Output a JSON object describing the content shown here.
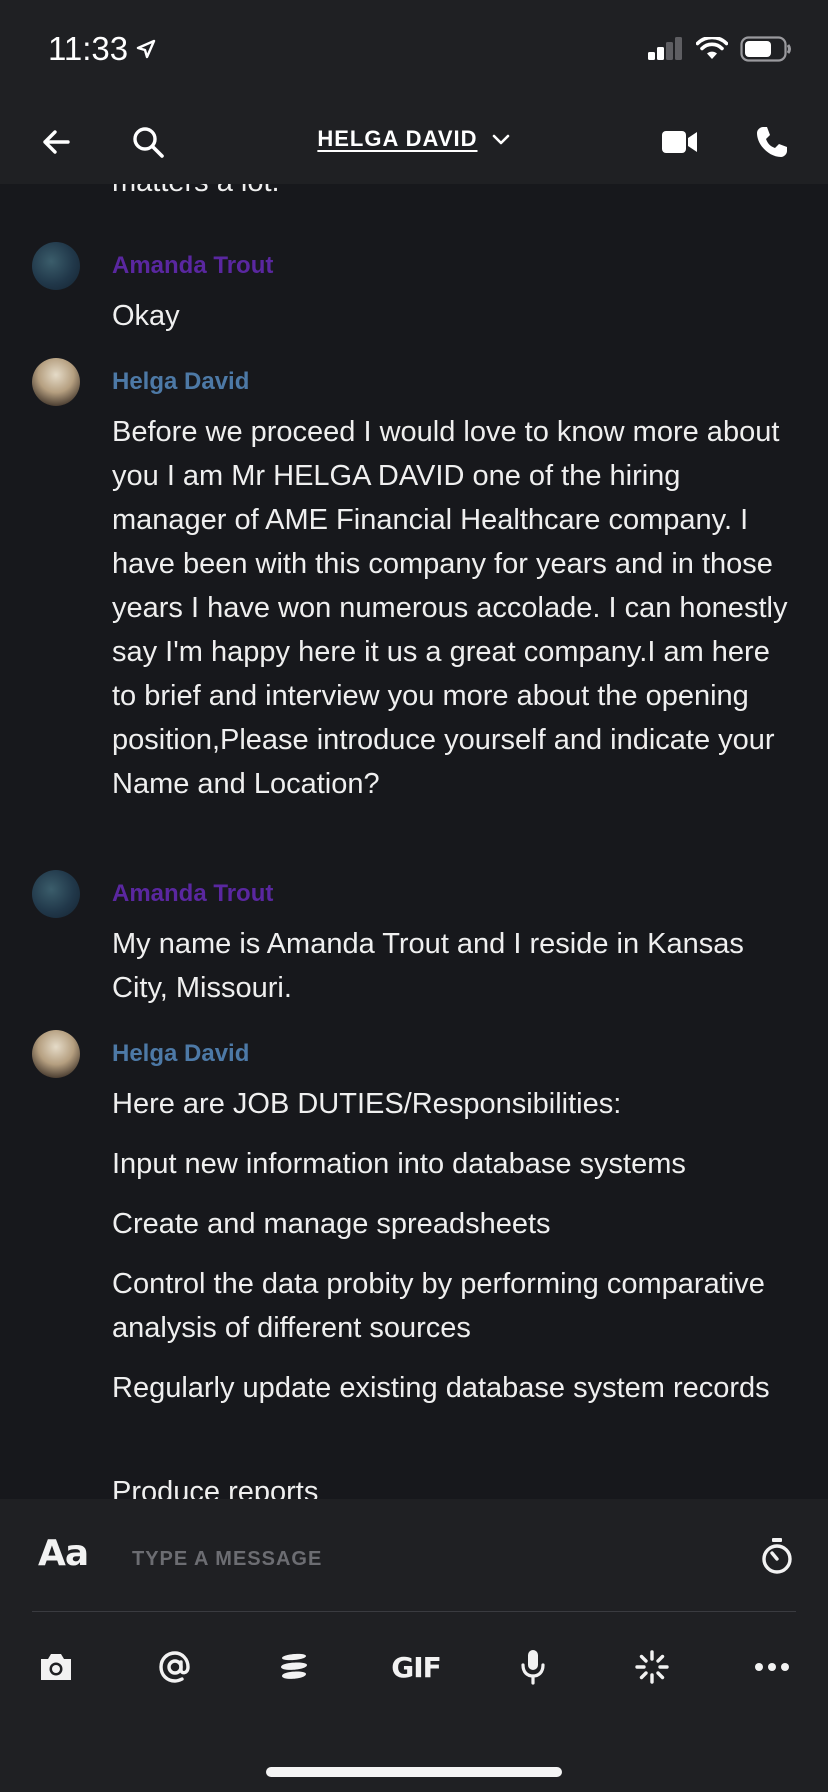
{
  "status_bar": {
    "time": "11:33"
  },
  "header": {
    "title": "HELGA DAVID"
  },
  "messages": [
    {
      "sender": "",
      "text": "matters a lot."
    },
    {
      "sender": "Amanda Trout",
      "text": "Okay"
    },
    {
      "sender": "Helga David",
      "text": "Before we proceed I would love to know more about you I am Mr HELGA DAVID one of the hiring manager of AME Financial Healthcare company. I have been with this company for years and in those years I have won numerous accolade. I can honestly say I'm happy here it us a great company.I am here to brief and interview you more about the opening position,Please introduce yourself and indicate your Name and Location?"
    },
    {
      "sender": "Amanda Trout",
      "text": "My name is Amanda Trout and I reside in Kansas City, Missouri."
    },
    {
      "sender": "Helga David",
      "lines": [
        "Here are JOB DUTIES/Responsibilities:",
        "Input new information into database systems",
        "Create and manage spreadsheets",
        "Control the data probity by performing comparative analysis of different sources",
        "Regularly update existing database system records",
        "Produce reports"
      ]
    }
  ],
  "composer": {
    "font_toggle_label": "Aa",
    "placeholder": "TYPE A MESSAGE",
    "gif_label": "GIF"
  },
  "icons": [
    "location-arrow-icon",
    "signal-icon",
    "wifi-icon",
    "battery-icon",
    "back-arrow-icon",
    "search-icon",
    "chevron-down-icon",
    "video-call-icon",
    "phone-icon",
    "timer-icon",
    "camera-icon",
    "mention-icon",
    "stack-icon",
    "microphone-icon",
    "sparkle-icon",
    "more-icon"
  ],
  "colors": {
    "amanda_name": "#5a27a0",
    "helga_name": "#4d79a6",
    "background": "#17181c",
    "bar": "#1f2023"
  }
}
